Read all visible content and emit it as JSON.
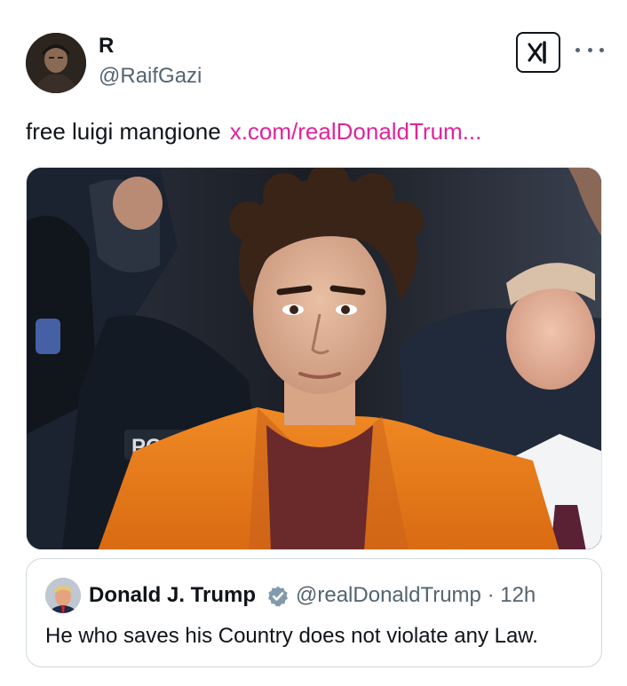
{
  "author": {
    "display_name": "R",
    "handle": "@RaifGazi",
    "avatar_icon": "user-avatar"
  },
  "actions": {
    "grok_icon": "grok-icon",
    "more_icon": "more-icon"
  },
  "tweet": {
    "text": "free luigi mangione",
    "link": "x.com/realDonaldTrum...",
    "link_color": "#e0249a",
    "media_badge_text": "POLIC"
  },
  "quote": {
    "display_name": "Donald J. Trump",
    "verified_icon": "verified-badge-icon",
    "handle": "@realDonaldTrump",
    "separator": "·",
    "time": "12h",
    "text": "He who saves his Country does not violate any Law."
  },
  "colors": {
    "text_primary": "#0f1419",
    "text_secondary": "#536471",
    "verified_gray": "#829aab",
    "border": "#cfd9de"
  }
}
